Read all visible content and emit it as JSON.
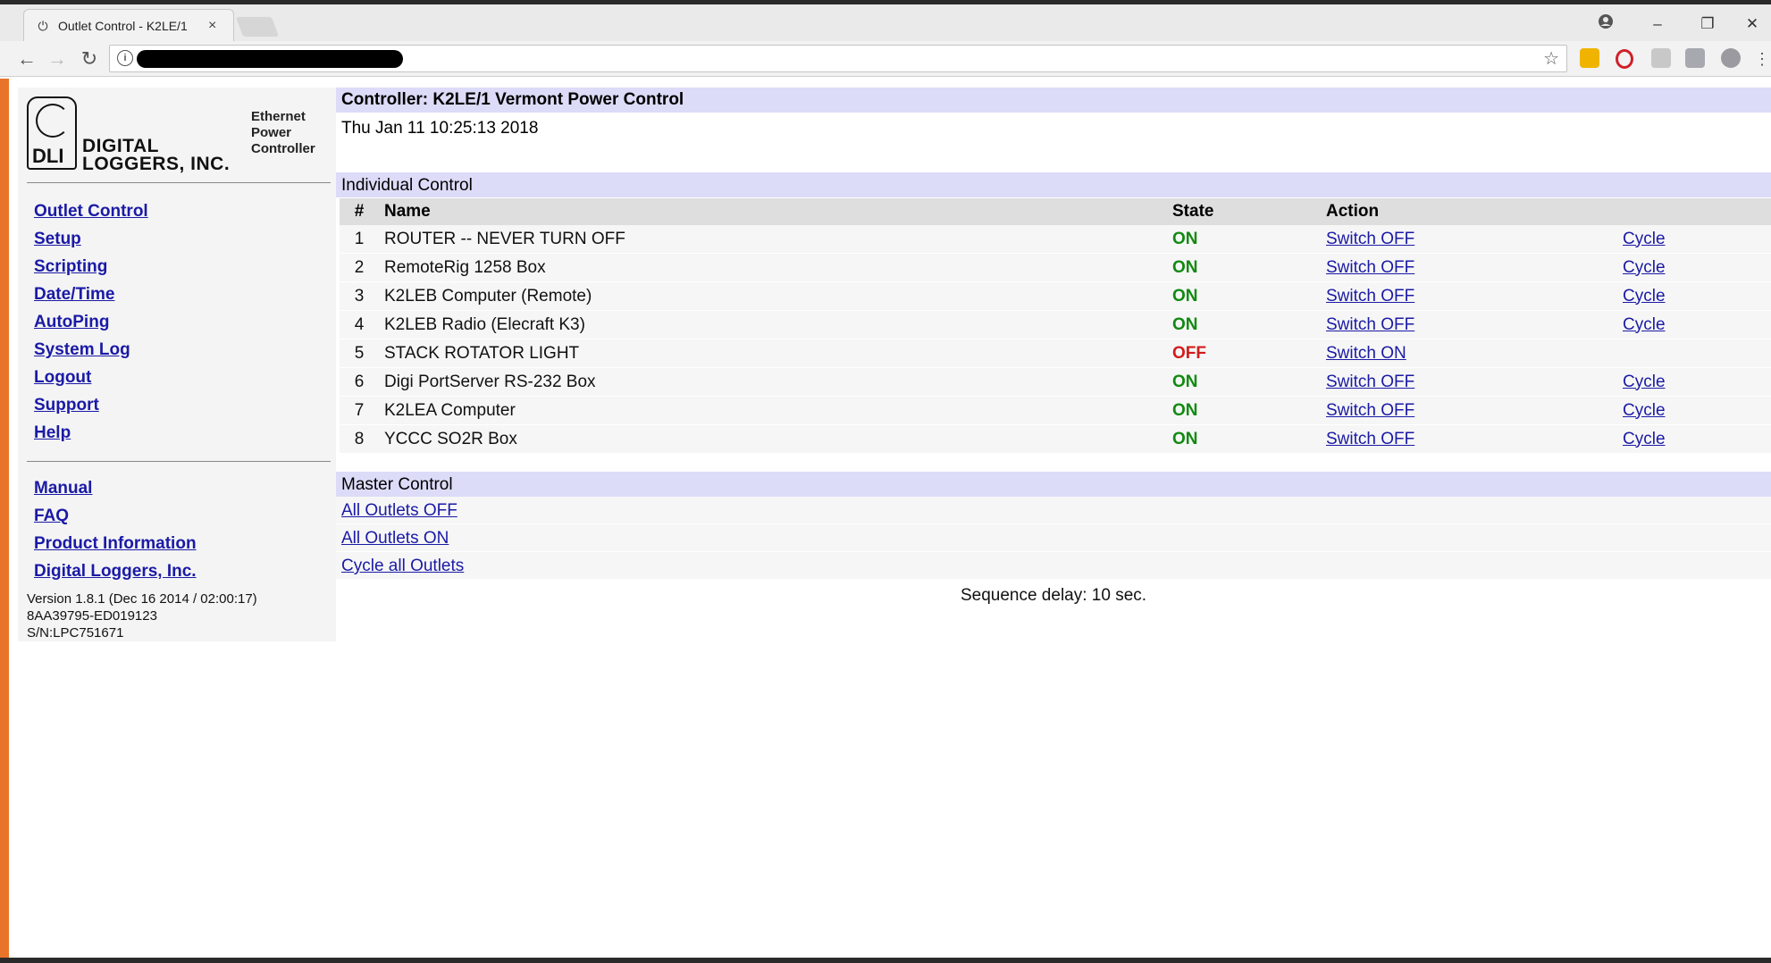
{
  "browser": {
    "tab_title": "Outlet Control - K2LE/1",
    "tab_close": "×",
    "win_min": "–",
    "win_max": "❐",
    "win_close": "✕",
    "back": "←",
    "forward": "→",
    "reload": "↻",
    "star": "☆",
    "info": "i"
  },
  "logo": {
    "mark": "DLI",
    "company_line1": "DIGITAL",
    "company_line2": "LOGGERS, INC.",
    "tagline": "Ethernet Power Controller"
  },
  "nav": {
    "primary": [
      "Outlet Control",
      "Setup",
      "Scripting",
      "Date/Time",
      "AutoPing",
      "System Log",
      "Logout",
      "Support",
      "Help"
    ],
    "secondary": [
      "Manual",
      "FAQ",
      "Product Information",
      "Digital Loggers, Inc."
    ]
  },
  "version": {
    "line1": "Version 1.8.1 (Dec 16 2014 / 02:00:17)",
    "line2": "8AA39795-ED019123",
    "line3": "S/N:LPC751671"
  },
  "main": {
    "controller_title": "Controller: K2LE/1 Vermont Power Control",
    "datetime": "Thu Jan 11 10:25:13 2018",
    "individual_title": "Individual Control",
    "columns": {
      "num": "#",
      "name": "Name",
      "state": "State",
      "action": "Action"
    },
    "outlets": [
      {
        "num": "1",
        "name": "ROUTER -- NEVER TURN OFF",
        "state": "ON",
        "action": "Switch OFF",
        "cycle": "Cycle"
      },
      {
        "num": "2",
        "name": "RemoteRig 1258 Box",
        "state": "ON",
        "action": "Switch OFF",
        "cycle": "Cycle"
      },
      {
        "num": "3",
        "name": "K2LEB Computer (Remote)",
        "state": "ON",
        "action": "Switch OFF",
        "cycle": "Cycle"
      },
      {
        "num": "4",
        "name": "K2LEB Radio (Elecraft K3)",
        "state": "ON",
        "action": "Switch OFF",
        "cycle": "Cycle"
      },
      {
        "num": "5",
        "name": "STACK ROTATOR LIGHT",
        "state": "OFF",
        "action": "Switch ON",
        "cycle": ""
      },
      {
        "num": "6",
        "name": "Digi PortServer RS-232 Box",
        "state": "ON",
        "action": "Switch OFF",
        "cycle": "Cycle"
      },
      {
        "num": "7",
        "name": "K2LEA Computer",
        "state": "ON",
        "action": "Switch OFF",
        "cycle": "Cycle"
      },
      {
        "num": "8",
        "name": "YCCC SO2R Box",
        "state": "ON",
        "action": "Switch OFF",
        "cycle": "Cycle"
      }
    ],
    "master_title": "Master Control",
    "master_links": [
      "All Outlets OFF",
      "All Outlets ON",
      "Cycle all Outlets"
    ],
    "sequence_delay": "Sequence delay: 10 sec."
  },
  "colors": {
    "state_on": "#118a11",
    "state_off": "#d41b1b",
    "link": "#1a1aa6",
    "header_bar": "#dcdcf8"
  }
}
